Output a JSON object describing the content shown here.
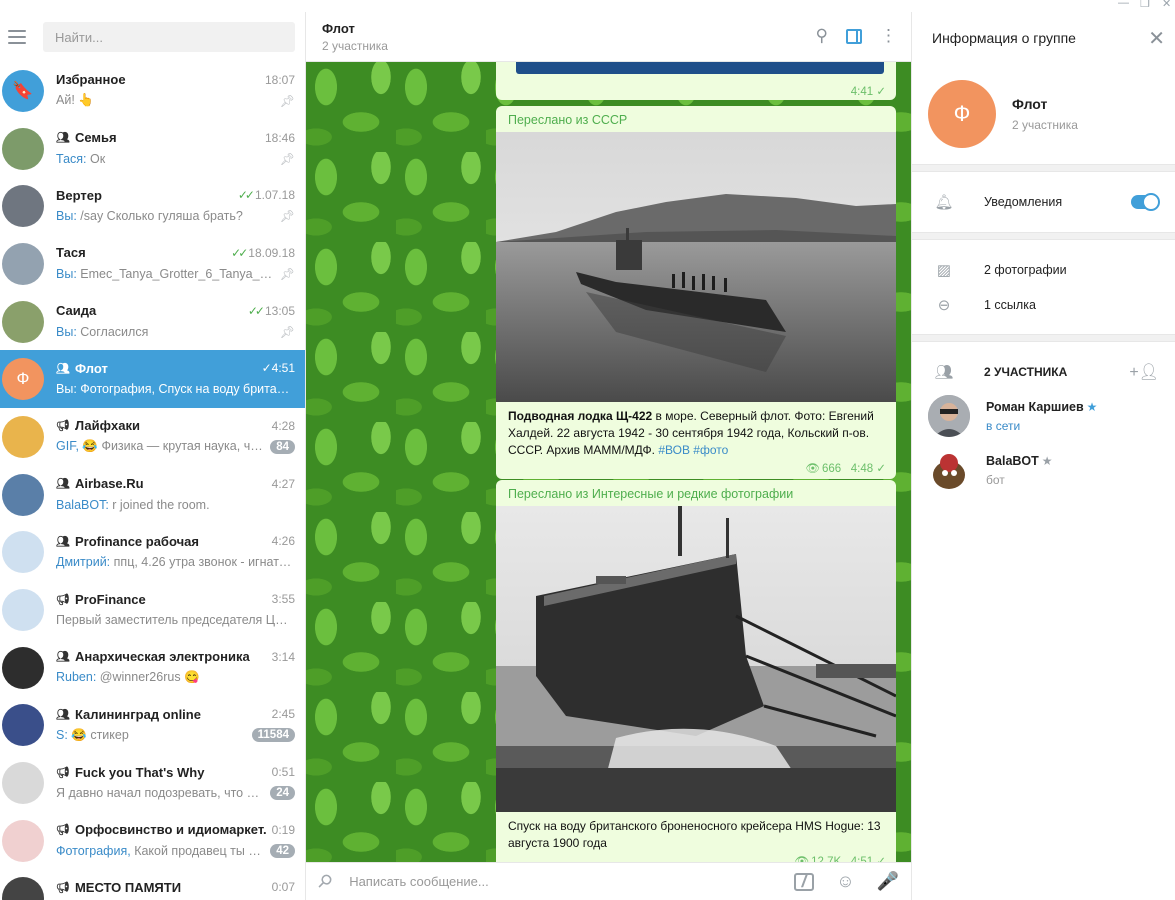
{
  "left": {
    "search_placeholder": "Найти...",
    "chats": [
      {
        "name": "Избранное",
        "time": "18:07",
        "who": "",
        "msg": "Ай! 👆",
        "badge": "",
        "pinned": true,
        "group": "",
        "check": "",
        "avatar_color": "#419fd9",
        "avatar_text": "🔖"
      },
      {
        "name": "Семья",
        "time": "18:46",
        "who": "Тася:",
        "msg": "Ок",
        "badge": "",
        "pinned": true,
        "group": "people",
        "check": "",
        "avatar_color": "#7d9b6a",
        "avatar_text": ""
      },
      {
        "name": "Вертер",
        "time": "1.07.18",
        "who": "Вы:",
        "msg": "/say Сколько гуляша брать?",
        "badge": "",
        "pinned": true,
        "group": "",
        "check": "double",
        "avatar_color": "#6f7680",
        "avatar_text": ""
      },
      {
        "name": "Тася",
        "time": "18.09.18",
        "who": "Вы:",
        "msg": "Emec_Tanya_Grotter_6_Tanya_Gr...",
        "badge": "",
        "pinned": true,
        "group": "",
        "check": "double",
        "avatar_color": "#93a2b0",
        "avatar_text": ""
      },
      {
        "name": "Саида",
        "time": "13:05",
        "who": "Вы:",
        "msg": "Согласился",
        "badge": "",
        "pinned": true,
        "group": "",
        "check": "double",
        "avatar_color": "#8aa06b",
        "avatar_text": ""
      },
      {
        "name": "Флот",
        "time": "4:51",
        "who": "Вы:",
        "msg": "Фотография, Спуск на воду британс...",
        "badge": "",
        "pinned": false,
        "group": "people",
        "check": "single",
        "avatar_color": "#f2945f",
        "avatar_text": "Ф"
      },
      {
        "name": "Лайфхаки",
        "time": "4:28",
        "who": "GIF,",
        "msg": "😂 Физика — крутая наука, чт...",
        "badge": "84",
        "pinned": false,
        "group": "megaphone",
        "check": "",
        "avatar_color": "#e9b44c",
        "avatar_text": ""
      },
      {
        "name": "Airbase.Ru",
        "time": "4:27",
        "who": "BalaBOT:",
        "msg": "r joined the room.",
        "badge": "",
        "pinned": false,
        "group": "people",
        "check": "",
        "avatar_color": "#5a7fa8",
        "avatar_text": ""
      },
      {
        "name": "Profinance рабочая",
        "time": "4:26",
        "who": "Дмитрий:",
        "msg": "ппц, 4.26 утра звонок - игнато...",
        "badge": "",
        "pinned": false,
        "group": "people",
        "check": "",
        "avatar_color": "#cfe0f0",
        "avatar_text": ""
      },
      {
        "name": "ProFinance",
        "time": "3:55",
        "who": "",
        "msg": "Первый заместитель председателя ЦБ Р...",
        "badge": "",
        "pinned": false,
        "group": "megaphone",
        "check": "",
        "avatar_color": "#cfe0f0",
        "avatar_text": ""
      },
      {
        "name": "Анархическая электроника",
        "time": "3:14",
        "who": "Ruben:",
        "msg": "@winner26rus 😋",
        "badge": "",
        "pinned": false,
        "group": "people",
        "check": "",
        "avatar_color": "#2d2d2d",
        "avatar_text": ""
      },
      {
        "name": "Калининград online",
        "time": "2:45",
        "who": "S:",
        "msg": "😂 стикер",
        "badge": "11584",
        "pinned": false,
        "group": "people",
        "check": "",
        "avatar_color": "#3a4f8a",
        "avatar_text": ""
      },
      {
        "name": "Fuck you That's Why",
        "time": "0:51",
        "who": "",
        "msg": "Я давно начал подозревать, что жу...",
        "badge": "24",
        "pinned": false,
        "group": "megaphone",
        "check": "",
        "avatar_color": "#d9d9d9",
        "avatar_text": ""
      },
      {
        "name": "Орфосвинство и идиомаркет...",
        "time": "0:19",
        "who": "Фотография,",
        "msg": "Какой продавец ты се...",
        "badge": "42",
        "pinned": false,
        "group": "megaphone",
        "check": "",
        "avatar_color": "#f0d0d0",
        "avatar_text": ""
      },
      {
        "name": "МЕСТО ПАМЯТИ",
        "time": "0:07",
        "who": "",
        "msg": "",
        "badge": "",
        "pinned": false,
        "group": "megaphone",
        "check": "",
        "avatar_color": "#444",
        "avatar_text": ""
      }
    ]
  },
  "chat": {
    "title": "Флот",
    "subtitle": "2 участника",
    "top_time": "4:41",
    "messages": [
      {
        "forwarded": "Переслано из СССР",
        "caption_bold": "Подводная лодка Щ-422",
        "caption": " в море. Северный флот. Фото: Евгений Халдей. 22 августа 1942 - 30 сентября 1942 года, Кольский п-ов. СССР. Архив МАММ/МДФ. ",
        "tags": "#ВОВ #фото",
        "views": "666",
        "time": "4:48"
      },
      {
        "forwarded": "Переслано из Интересные и редкие фотографии",
        "caption_bold": "",
        "caption": "Спуск на воду британского броненосного крейсера HMS Hogue: 13 августа 1900 года",
        "tags": "",
        "views": "12.7K",
        "time": "4:51"
      }
    ],
    "composer_placeholder": "Написать сообщение..."
  },
  "info": {
    "title": "Информация о группе",
    "group_name": "Флот",
    "avatar_letter": "Ф",
    "member_count": "2 участника",
    "notifications_label": "Уведомления",
    "notifications_on": true,
    "photos_label": "2 фотографии",
    "links_label": "1 ссылка",
    "members_heading": "2 УЧАСТНИКА",
    "members": [
      {
        "name": "Роман Каршиев",
        "status": "в сети",
        "star": "★"
      },
      {
        "name": "BalaBOT",
        "status": "бот",
        "star": "★"
      }
    ]
  }
}
